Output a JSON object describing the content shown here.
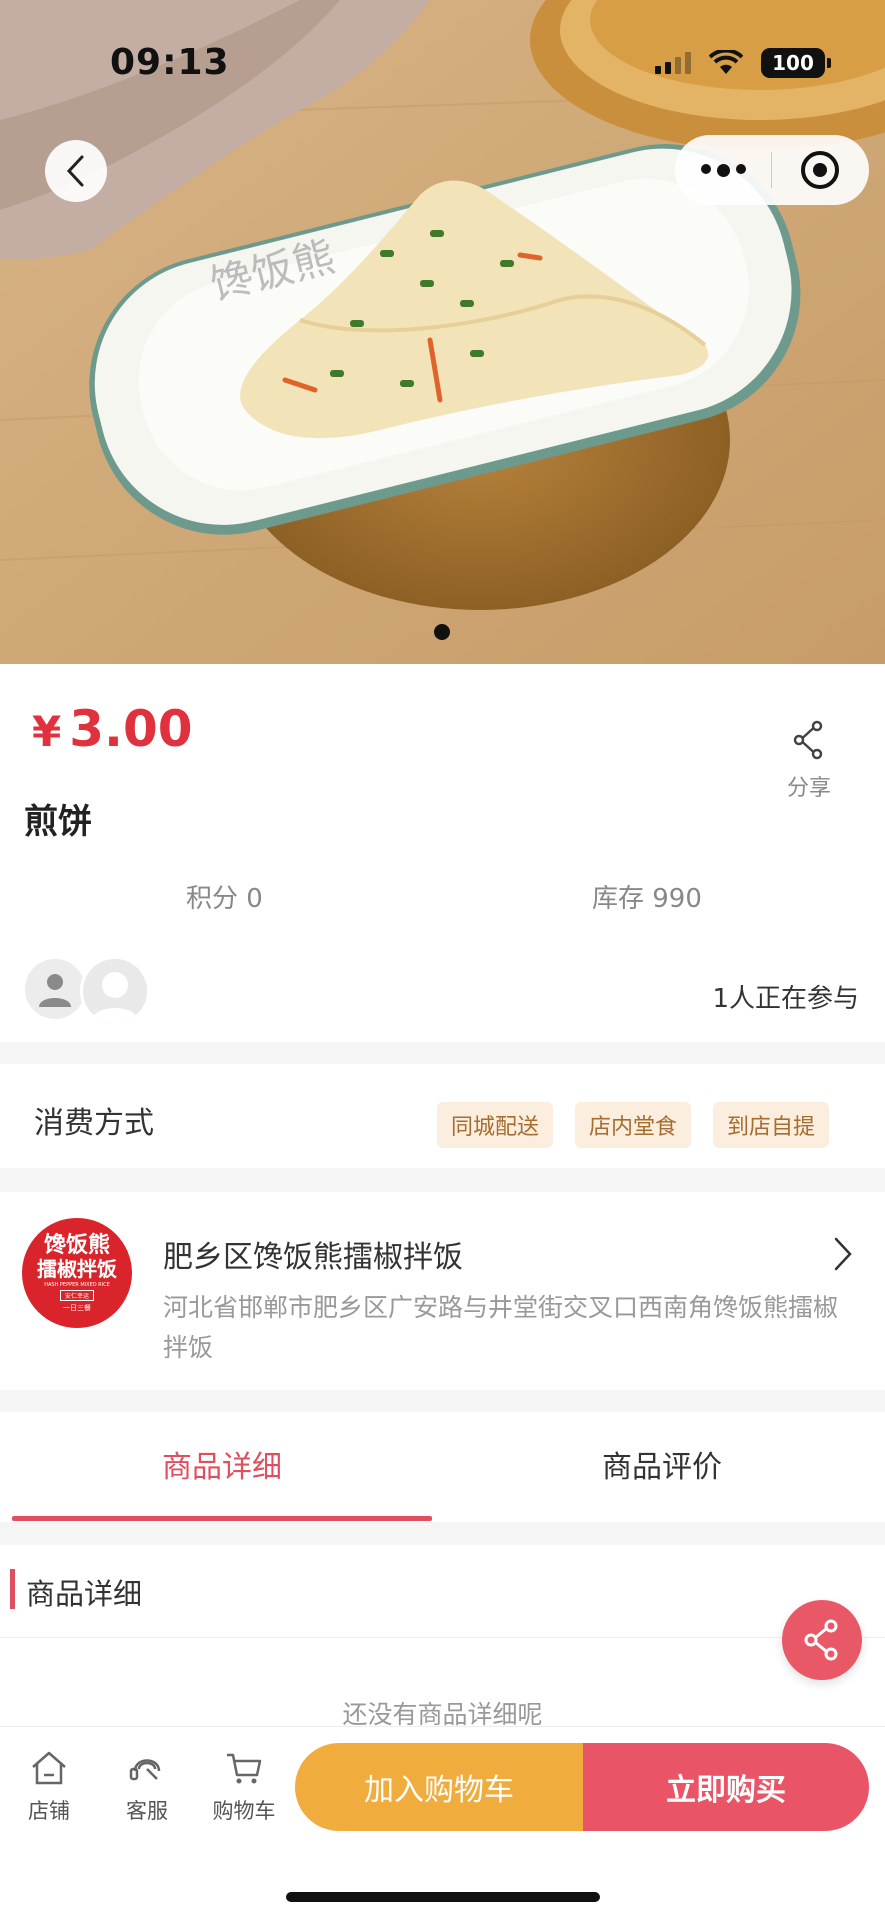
{
  "status_bar": {
    "time": "09:13",
    "battery": "100"
  },
  "nav": {
    "back_icon": "chevron-left-icon",
    "more_icon": "more-dots-icon",
    "close_icon": "target-circle-icon"
  },
  "product": {
    "currency": "¥",
    "price": "3.00",
    "name": "煎饼",
    "share_label": "分享",
    "points": "积分 0",
    "stock": "库存 990",
    "participants": "1人正在参与"
  },
  "consumption": {
    "title": "消费方式",
    "tags": [
      "同城配送",
      "店内堂食",
      "到店自提"
    ]
  },
  "store": {
    "logo_line1": "馋饭熊",
    "logo_line2": "擂椒拌饭",
    "logo_line3": "HASH PEPPER MIXED RICE",
    "logo_line4": "安仁幸运",
    "logo_line5": "一日三餐",
    "name": "肥乡区馋饭熊擂椒拌饭",
    "address": "河北省邯郸市肥乡区广安路与井堂街交叉口西南角馋饭熊擂椒拌饭"
  },
  "tabs": [
    {
      "label": "商品详细",
      "active": true
    },
    {
      "label": "商品评价",
      "active": false
    }
  ],
  "detail": {
    "title": "商品详细",
    "empty_text": "还没有商品详细呢"
  },
  "bottom_bar": {
    "shop": "店铺",
    "service": "客服",
    "cart": "购物车",
    "add_to_cart": "加入购物车",
    "buy_now": "立即购买"
  },
  "colors": {
    "price": "#e0323e",
    "accent": "#e04f5f",
    "add_to_cart": "#f0ad3e",
    "buy_now": "#ea5467",
    "tag_bg": "#fbeede"
  }
}
